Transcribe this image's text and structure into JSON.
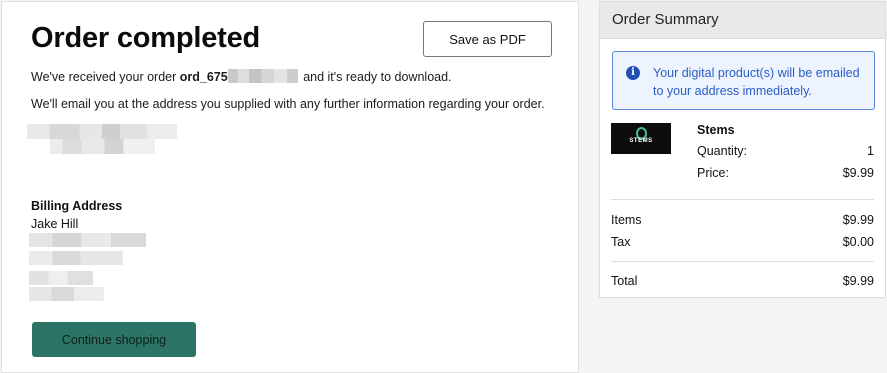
{
  "main": {
    "title": "Order completed",
    "save_pdf_label": "Save as PDF",
    "received_prefix": "We've received your order",
    "order_id_visible": "ord_675",
    "received_suffix": "and it's ready to download.",
    "email_notice": "We'll email you at the address you supplied with any further information regarding your order.",
    "billing": {
      "heading": "Billing Address",
      "name": "Jake Hill"
    },
    "continue_label": "Continue shopping"
  },
  "summary": {
    "title": "Order Summary",
    "info_message": "Your digital product(s) will be emailed to your address immediately.",
    "product": {
      "name": "Stems",
      "thumbnail_text": "STEMS",
      "quantity_label": "Quantity:",
      "quantity": "1",
      "price_label": "Price:",
      "price": "$9.99"
    },
    "items_label": "Items",
    "items_value": "$9.99",
    "tax_label": "Tax",
    "tax_value": "$0.00",
    "total_label": "Total",
    "total_value": "$9.99"
  },
  "colors": {
    "primary_button": "#2c7566",
    "info_border": "#5a86d6",
    "info_text": "#2a5dc3",
    "info_background": "#eef4ff"
  }
}
